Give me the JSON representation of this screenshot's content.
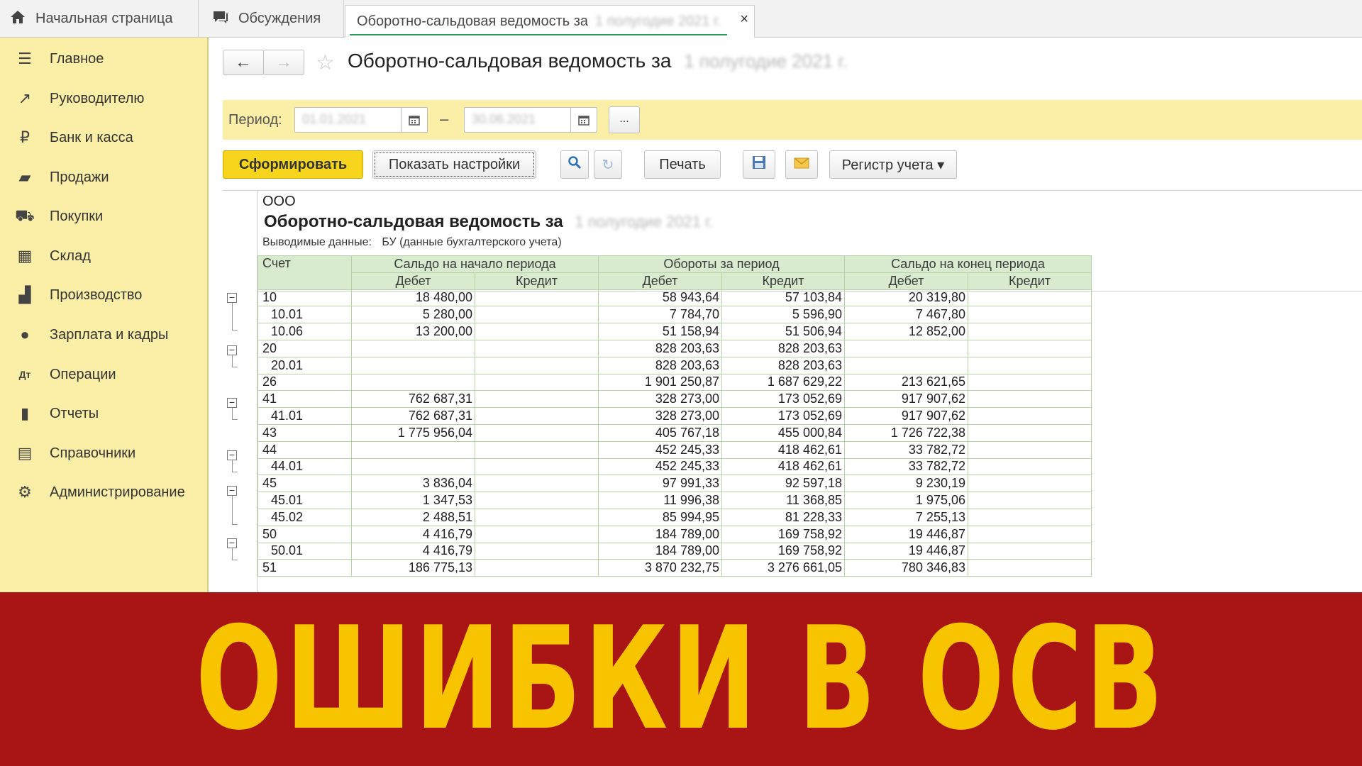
{
  "tabs": [
    {
      "label": "Начальная страница",
      "icon": "home-icon"
    },
    {
      "label": "Обсуждения",
      "icon": "chat-icon"
    },
    {
      "label": "Оборотно-сальдовая ведомость за",
      "icon": "",
      "blurred_suffix": "1 полугодие 2021 г.",
      "close": "×"
    }
  ],
  "sidebar": {
    "items": [
      {
        "label": "Главное",
        "icon": "menu-icon",
        "glyph": "☰"
      },
      {
        "label": "Руководителю",
        "icon": "trend-icon",
        "glyph": "↗"
      },
      {
        "label": "Банк и касса",
        "icon": "ruble-icon",
        "glyph": "₽"
      },
      {
        "label": "Продажи",
        "icon": "bag-icon",
        "glyph": "▰"
      },
      {
        "label": "Покупки",
        "icon": "cart-icon",
        "glyph": "⛟"
      },
      {
        "label": "Склад",
        "icon": "warehouse-icon",
        "glyph": "▦"
      },
      {
        "label": "Производство",
        "icon": "factory-icon",
        "glyph": "▟"
      },
      {
        "label": "Зарплата и кадры",
        "icon": "person-icon",
        "glyph": "●"
      },
      {
        "label": "Операции",
        "icon": "dt-kt-icon",
        "glyph": "Дт"
      },
      {
        "label": "Отчеты",
        "icon": "bar-chart-icon",
        "glyph": "▮"
      },
      {
        "label": "Справочники",
        "icon": "book-icon",
        "glyph": "▤"
      },
      {
        "label": "Администрирование",
        "icon": "gear-icon",
        "glyph": "⚙"
      }
    ]
  },
  "header": {
    "back": "←",
    "forward": "→",
    "star": "☆",
    "title": "Оборотно-сальдовая ведомость за",
    "title_blurred": "1 полугодие 2021 г."
  },
  "period": {
    "label": "Период:",
    "from": "01.01.2021",
    "to": "30.06.2021",
    "dash": "–",
    "more": "..."
  },
  "toolbar": {
    "generate": "Сформировать",
    "show_settings": "Показать настройки",
    "search": "🔍",
    "refresh": "↻",
    "print": "Печать",
    "save": "💾",
    "mail": "✉",
    "register": "Регистр учета ▾"
  },
  "report": {
    "org": "ООО",
    "title": "Оборотно-сальдовая ведомость за",
    "title_blurred": "1 полугодие 2021 г.",
    "output_label": "Выводимые данные:",
    "output_value": "БУ (данные бухгалтерского учета)",
    "columns": {
      "account": "Счет",
      "opening": "Сальдо на начало периода",
      "turnover": "Обороты за период",
      "closing": "Сальдо на конец периода",
      "debit": "Дебет",
      "credit": "Кредит"
    },
    "rows": [
      {
        "account": "10",
        "sub": false,
        "od": "18 480,00",
        "oc": "",
        "td": "58 943,64",
        "tc": "57 103,84",
        "cd": "20 319,80",
        "cc": ""
      },
      {
        "account": "10.01",
        "sub": true,
        "od": "5 280,00",
        "oc": "",
        "td": "7 784,70",
        "tc": "5 596,90",
        "cd": "7 467,80",
        "cc": ""
      },
      {
        "account": "10.06",
        "sub": true,
        "od": "13 200,00",
        "oc": "",
        "td": "51 158,94",
        "tc": "51 506,94",
        "cd": "12 852,00",
        "cc": ""
      },
      {
        "account": "20",
        "sub": false,
        "od": "",
        "oc": "",
        "td": "828 203,63",
        "tc": "828 203,63",
        "cd": "",
        "cc": ""
      },
      {
        "account": "20.01",
        "sub": true,
        "od": "",
        "oc": "",
        "td": "828 203,63",
        "tc": "828 203,63",
        "cd": "",
        "cc": ""
      },
      {
        "account": "26",
        "sub": false,
        "od": "",
        "oc": "",
        "td": "1 901 250,87",
        "tc": "1 687 629,22",
        "cd": "213 621,65",
        "cc": ""
      },
      {
        "account": "41",
        "sub": false,
        "od": "762 687,31",
        "oc": "",
        "td": "328 273,00",
        "tc": "173 052,69",
        "cd": "917 907,62",
        "cc": ""
      },
      {
        "account": "41.01",
        "sub": true,
        "od": "762 687,31",
        "oc": "",
        "td": "328 273,00",
        "tc": "173 052,69",
        "cd": "917 907,62",
        "cc": ""
      },
      {
        "account": "43",
        "sub": false,
        "od": "1 775 956,04",
        "oc": "",
        "td": "405 767,18",
        "tc": "455 000,84",
        "cd": "1 726 722,38",
        "cc": ""
      },
      {
        "account": "44",
        "sub": false,
        "od": "",
        "oc": "",
        "td": "452 245,33",
        "tc": "418 462,61",
        "cd": "33 782,72",
        "cc": ""
      },
      {
        "account": "44.01",
        "sub": true,
        "od": "",
        "oc": "",
        "td": "452 245,33",
        "tc": "418 462,61",
        "cd": "33 782,72",
        "cc": ""
      },
      {
        "account": "45",
        "sub": false,
        "od": "3 836,04",
        "oc": "",
        "td": "97 991,33",
        "tc": "92 597,18",
        "cd": "9 230,19",
        "cc": ""
      },
      {
        "account": "45.01",
        "sub": true,
        "od": "1 347,53",
        "oc": "",
        "td": "11 996,38",
        "tc": "11 368,85",
        "cd": "1 975,06",
        "cc": ""
      },
      {
        "account": "45.02",
        "sub": true,
        "od": "2 488,51",
        "oc": "",
        "td": "85 994,95",
        "tc": "81 228,33",
        "cd": "7 255,13",
        "cc": ""
      },
      {
        "account": "50",
        "sub": false,
        "od": "4 416,79",
        "oc": "",
        "td": "184 789,00",
        "tc": "169 758,92",
        "cd": "19 446,87",
        "cc": ""
      },
      {
        "account": "50.01",
        "sub": true,
        "od": "4 416,79",
        "oc": "",
        "td": "184 789,00",
        "tc": "169 758,92",
        "cd": "19 446,87",
        "cc": ""
      },
      {
        "account": "51",
        "sub": false,
        "od": "186 775,13",
        "oc": "",
        "td": "3 870 232,75",
        "tc": "3 276 661,05",
        "cd": "780 346,83",
        "cc": ""
      }
    ]
  },
  "banner": {
    "text": "ОШИБКИ В ОСВ"
  },
  "colors": {
    "sidebar_bg": "#fbeea6",
    "primary_button": "#f7d51c",
    "table_header": "#d9ebce",
    "banner_bg": "#a91515",
    "banner_text": "#f8c400"
  }
}
